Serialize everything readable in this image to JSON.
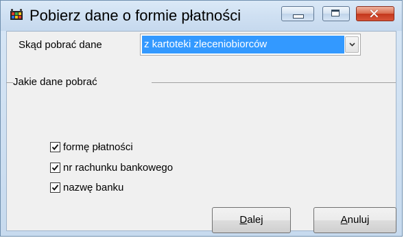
{
  "window": {
    "title": "Pobierz dane o formie płatności",
    "buttons": {
      "minimize": "minimize-icon",
      "maximize": "maximize-icon",
      "close": "close-icon"
    }
  },
  "source": {
    "label": "Skąd pobrać dane",
    "selected": "z kartoteki zleceniobiorców"
  },
  "group": {
    "label": "Jakie dane pobrać",
    "options": [
      {
        "label": "formę płatności",
        "checked": true
      },
      {
        "label": "nr rachunku bankowego",
        "checked": true
      },
      {
        "label": "nazwę banku",
        "checked": true
      }
    ]
  },
  "actions": {
    "next_accel": "D",
    "next_rest": "alej",
    "cancel_accel": "A",
    "cancel_rest": "nuluj"
  },
  "colors": {
    "selection": "#3399ff",
    "close_button": "#c4371c",
    "titlebar": "#cfe0f2"
  }
}
